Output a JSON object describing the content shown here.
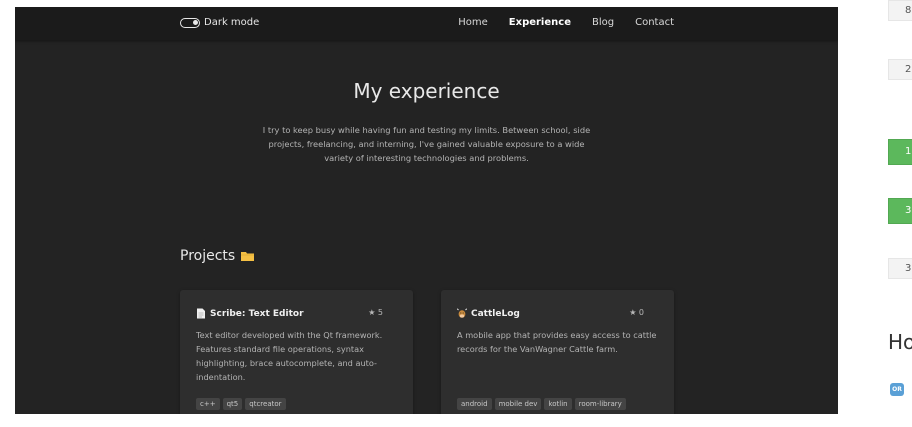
{
  "navbar": {
    "toggle_label": "Dark mode",
    "links": [
      "Home",
      "Experience",
      "Blog",
      "Contact"
    ],
    "active_link": "Experience"
  },
  "hero": {
    "title": "My experience",
    "description": "I try to keep busy while having fun and testing my limits. Between school, side projects, freelancing, and interning, I've gained valuable exposure to a wide variety of interesting technologies and problems."
  },
  "projects": {
    "title": "Projects",
    "cards": [
      {
        "title": "Scribe: Text Editor",
        "icon": "document-icon",
        "stars": "5",
        "description": "Text editor developed with the Qt framework. Features standard file operations, syntax highlighting, brace autocomplete, and auto-indentation.",
        "tags": [
          "c++",
          "qt5",
          "qtcreator"
        ]
      },
      {
        "title": "CattleLog",
        "icon": "cow-icon",
        "stars": "0",
        "description": "A mobile app that provides easy access to cattle records for the VanWagner Cattle farm.",
        "tags": [
          "android",
          "mobile dev",
          "kotlin",
          "room-library"
        ]
      }
    ]
  },
  "right_panel": {
    "boxes": [
      "8",
      "2",
      "1",
      "3",
      "3"
    ],
    "heading": "Ho",
    "icon_label": "OR"
  },
  "colors": {
    "page_bg": "#232323",
    "navbar_bg": "#1b1b1b",
    "card_bg": "#2e2e2e",
    "folder": "#f5c044",
    "accent_green": "#5cb85c"
  }
}
